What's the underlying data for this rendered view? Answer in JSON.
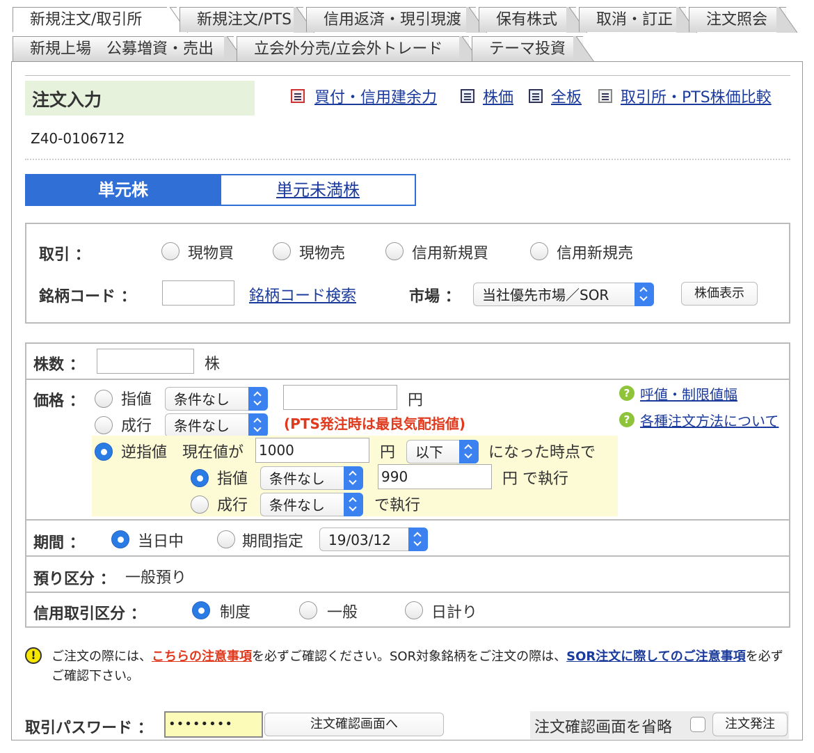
{
  "tabs_row1": [
    "新規注文/取引所",
    "新規注文/PTS",
    "信用返済・現引現渡",
    "保有株式",
    "取消・訂正",
    "注文照会"
  ],
  "tabs_row2": [
    "新規上場　公募増資・売出",
    "立会外分売/立会外トレード",
    "テーマ投資"
  ],
  "header": {
    "title": "注文入力",
    "links": [
      "買付・信用建余力",
      "株価",
      "全板",
      "取引所・PTS株価比較"
    ],
    "code": "Z40-0106712"
  },
  "unit_tabs": {
    "active": "単元株",
    "other": "単元未満株"
  },
  "trade": {
    "label": "取引 ：",
    "options": [
      "現物買",
      "現物売",
      "信用新規買",
      "信用新規売"
    ],
    "code_label": "銘柄コード ：",
    "code_search": "銘柄コード検索",
    "market_label": "市場 ：",
    "market_value": "当社優先市場／SOR",
    "quote_button": "株価表示"
  },
  "shares": {
    "label": "株数 ：",
    "unit": "株",
    "value": ""
  },
  "price": {
    "label": "価格 ：",
    "limit": "指値",
    "limit_cond": "条件なし",
    "yen": "円",
    "market": "成行",
    "market_cond": "条件なし",
    "pts_note": "(PTS発注時は最良気配指値)",
    "help1": "呼値・制限値幅",
    "help2": "各種注文方法について",
    "stop": "逆指値",
    "stop_prefix": "現在値が",
    "stop_price": "1000",
    "stop_dir": "以下",
    "stop_suffix": "になった時点で",
    "stop_limit": "指値",
    "stop_limit_cond": "条件なし",
    "stop_limit_price": "990",
    "exec_suffix": "円  で執行",
    "stop_market": "成行",
    "stop_market_cond": "条件なし",
    "exec_suffix2": "で執行"
  },
  "period": {
    "label": "期間 ：",
    "today": "当日中",
    "specify": "期間指定",
    "date": "19/03/12"
  },
  "custody": {
    "label": "預り区分 ：",
    "value": "一般預り"
  },
  "margin": {
    "label": "信用取引区分 ：",
    "options": [
      "制度",
      "一般",
      "日計り"
    ]
  },
  "notice": {
    "pre": "ご注文の際には、",
    "link1": "こちらの注意事項",
    "mid": "を必ずご確認ください。SOR対象銘柄をご注文の際は、",
    "link2a": "SOR注文に際してのご注",
    "link2b": "意事項",
    "post": "を必ずご確認下さい。"
  },
  "footer": {
    "password_label": "取引パスワード ：",
    "password_value": "••••••••",
    "confirm_button": "注文確認画面へ",
    "skip_label": "注文確認画面を省略",
    "submit_button": "注文発注"
  },
  "colors": {
    "accent": "#2f6fd6",
    "title_bg": "#e7f2dc",
    "stop_bg": "#fdfbd6",
    "warn": "#e03a1e",
    "link": "#1a3a9c"
  }
}
